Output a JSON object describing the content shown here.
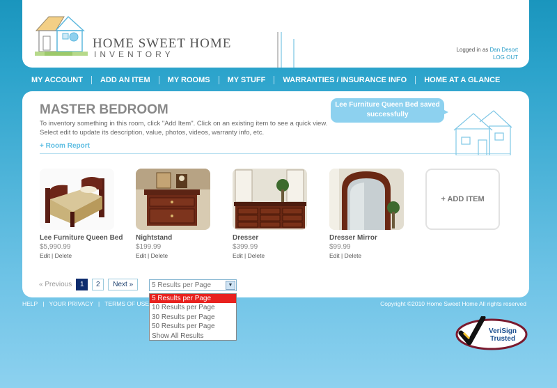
{
  "header": {
    "logo_line1": "HOME SWEET HOME",
    "logo_line2": "INVENTORY",
    "logged_in_prefix": "Logged in as",
    "user_name": "Dan Desort",
    "logout_label": "LOG OUT"
  },
  "nav": {
    "items": [
      "MY ACCOUNT",
      "ADD AN ITEM",
      "MY ROOMS",
      "MY STUFF",
      "WARRANTIES / INSURANCE INFO",
      "HOME AT A GLANCE"
    ]
  },
  "room": {
    "title": "MASTER BEDROOM",
    "description": "To inventory something in this room, click \"Add Item\". Click on an existing item to see a quick view. Select edit to update its description, value, photos, videos, warranty info, etc.",
    "report_link": "+ Room Report",
    "notification": "Lee Furniture Queen Bed saved successfully"
  },
  "items": [
    {
      "name": "Lee Furniture Queen Bed",
      "price": "$5,990.99",
      "edit": "Edit",
      "delete": "Delete",
      "icon": "bed-photo"
    },
    {
      "name": "Nightstand",
      "price": "$199.99",
      "edit": "Edit",
      "delete": "Delete",
      "icon": "nightstand-photo"
    },
    {
      "name": "Dresser",
      "price": "$399.99",
      "edit": "Edit",
      "delete": "Delete",
      "icon": "dresser-photo"
    },
    {
      "name": "Dresser Mirror",
      "price": "$99.99",
      "edit": "Edit",
      "delete": "Delete",
      "icon": "mirror-photo"
    }
  ],
  "add_item_label": "+ ADD ITEM",
  "pagination": {
    "prev_label": "« Previous",
    "pages": [
      "1",
      "2"
    ],
    "current_page": "1",
    "next_label": "Next »"
  },
  "results_select": {
    "selected": "5 Results per Page",
    "options": [
      "5 Results per Page",
      "10 Results per Page",
      "30 Results per Page",
      "50 Results per Page",
      "Show All Results"
    ]
  },
  "footer": {
    "links": [
      "HELP",
      "YOUR PRIVACY",
      "TERMS OF USE"
    ],
    "copyright": "Copyright ©2010 Home Sweet Home All rights reserved",
    "verisign_line1": "VeriSign",
    "verisign_line2": "Trusted"
  },
  "colors": {
    "accent": "#2ba3cb",
    "select_highlight": "#e8211e",
    "active_page": "#0d2c6e"
  }
}
